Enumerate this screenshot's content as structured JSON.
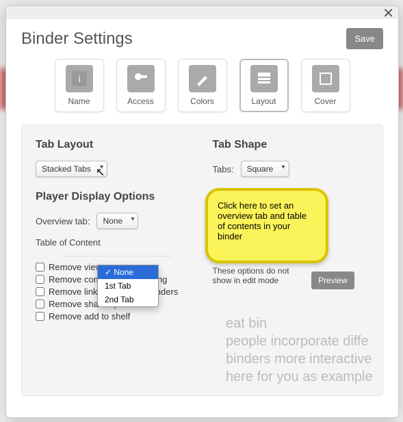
{
  "modal": {
    "title": "Binder Settings",
    "save": "Save",
    "tabs": {
      "name": "Name",
      "access": "Access",
      "colors": "Colors",
      "layout": "Layout",
      "cover": "Cover"
    }
  },
  "tab_layout": {
    "heading": "Tab Layout",
    "select_value": "Stacked Tabs"
  },
  "tab_shape": {
    "heading": "Tab Shape",
    "label": "Tabs:",
    "select_value": "Square"
  },
  "player": {
    "heading": "Player Display Options",
    "overview_label": "Overview tab:",
    "overview_value": "None",
    "toc_label": "Table of Content",
    "dropdown_options": [
      "None",
      "1st Tab",
      "2nd Tab"
    ],
    "checks": {
      "views": "Remove views",
      "comments": "Remove comments and rating",
      "link": "Remove link to Featured Binders",
      "share": "Remove share options",
      "shelf": "Remove add to shelf"
    }
  },
  "right_note": {
    "text": "These options do not show in edit mode",
    "preview": "Preview"
  },
  "callout": {
    "text": "Click here to set an overview tab and table of contents in your binder"
  },
  "bg": {
    "toc": "Table of C",
    "l1": "eat bin",
    "l2": "people incorporate diffe",
    "l3": "binders more interactive",
    "l4": "here for you as example"
  }
}
